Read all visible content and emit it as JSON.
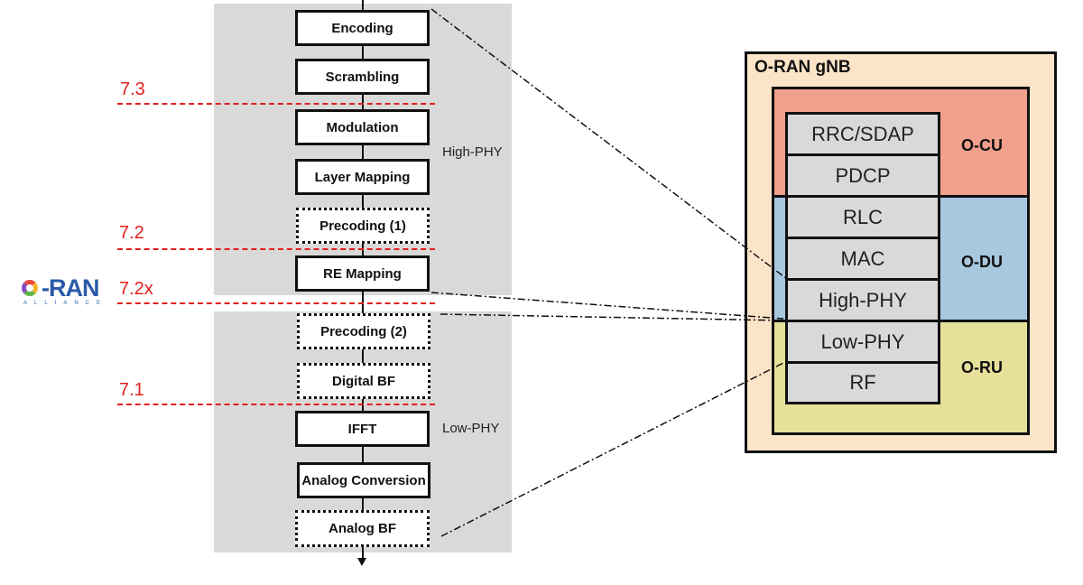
{
  "chain": {
    "blocks": [
      {
        "label": "Encoding",
        "style": "solid"
      },
      {
        "label": "Scrambling",
        "style": "solid"
      },
      {
        "label": "Modulation",
        "style": "solid"
      },
      {
        "label": "Layer Mapping",
        "style": "solid"
      },
      {
        "label": "Precoding (1)",
        "style": "dotted"
      },
      {
        "label": "RE Mapping",
        "style": "solid"
      },
      {
        "label": "Precoding (2)",
        "style": "dotted"
      },
      {
        "label": "Digital BF",
        "style": "dotted"
      },
      {
        "label": "IFFT",
        "style": "solid"
      },
      {
        "label": "Analog Conversion",
        "style": "solid"
      },
      {
        "label": "Analog BF",
        "style": "dotted"
      }
    ],
    "high_phy_label": "High-PHY",
    "low_phy_label": "Low-PHY"
  },
  "splits": [
    {
      "label": "7.3"
    },
    {
      "label": "7.2"
    },
    {
      "label": "7.2x"
    },
    {
      "label": "7.1"
    }
  ],
  "logo": {
    "name": "O-RAN",
    "text": "-RAN",
    "subtitle": "ALLIANCE"
  },
  "gnb": {
    "title": "O-RAN gNB",
    "units": [
      {
        "label": "O-CU",
        "color": "#f0a08c"
      },
      {
        "label": "O-DU",
        "color": "#a8c8e0"
      },
      {
        "label": "O-RU",
        "color": "#e6e09a"
      }
    ],
    "layers": [
      "RRC/SDAP",
      "PDCP",
      "RLC",
      "MAC",
      "High-PHY",
      "Low-PHY",
      "RF"
    ]
  },
  "colors": {
    "split_line": "#e02020",
    "panel": "#d9d9d9",
    "gnb_bg": "#fce4c8"
  }
}
